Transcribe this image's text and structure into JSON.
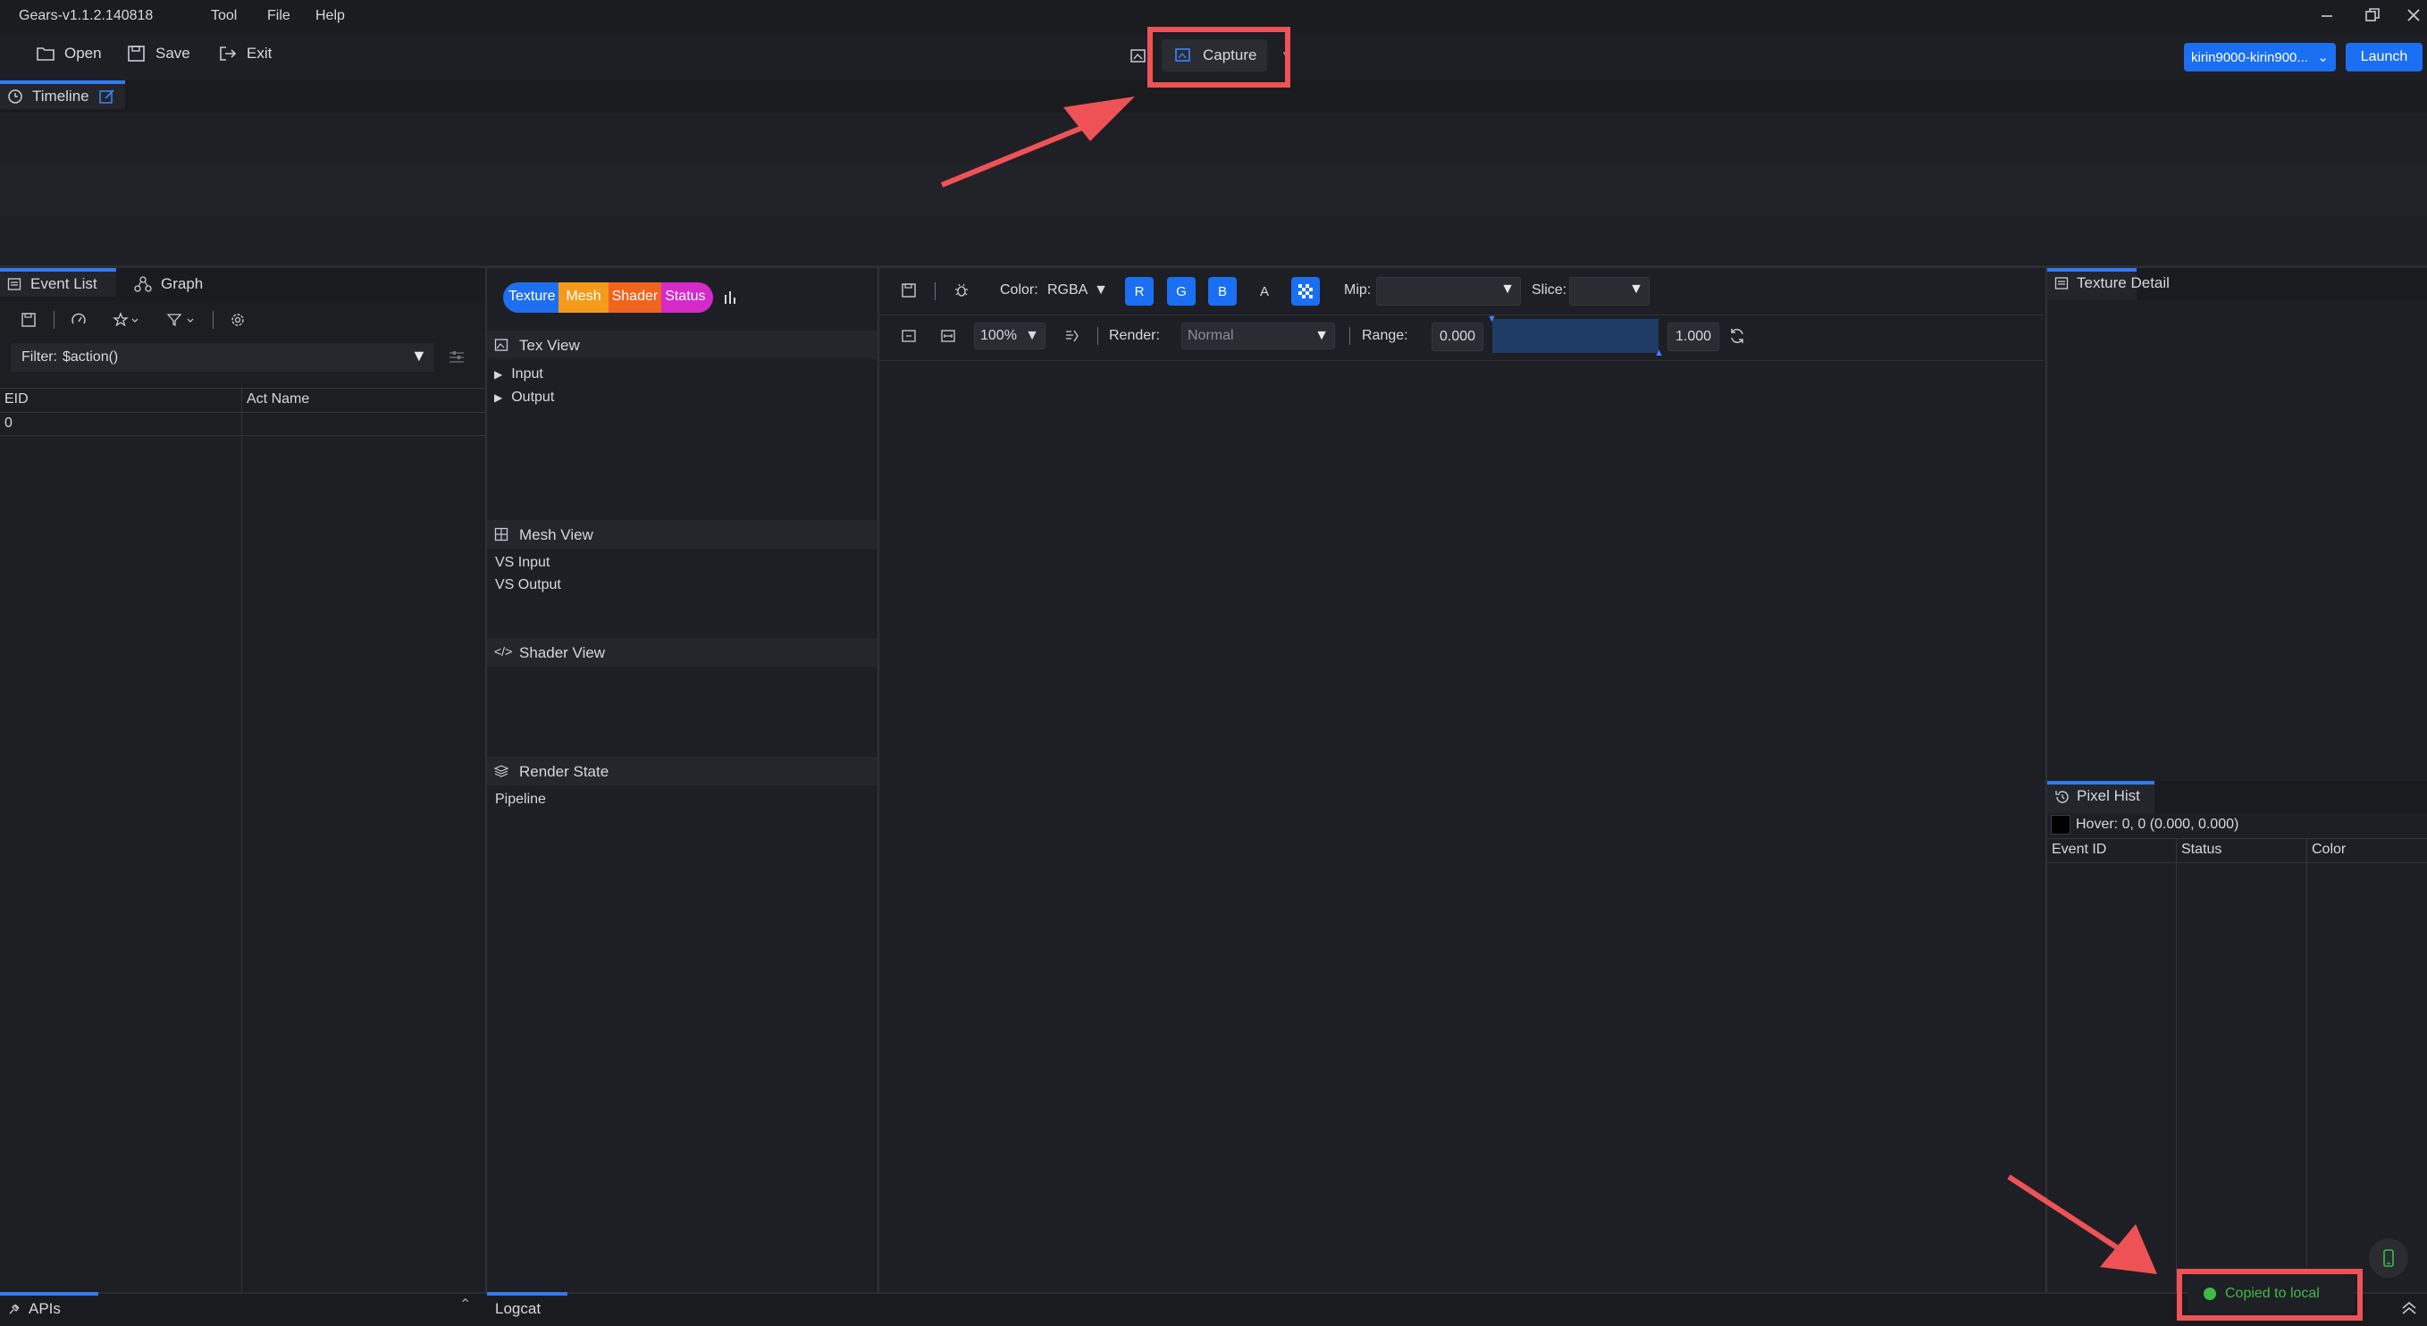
{
  "app": {
    "title": "Gears-v1.1.2.140818",
    "menu": [
      "Tool",
      "File",
      "Help"
    ]
  },
  "toolbar": {
    "open_label": "Open",
    "save_label": "Save",
    "exit_label": "Exit",
    "capture_label": "Capture",
    "device_value": "kirin9000-kirin900...",
    "launch_label": "Launch"
  },
  "timeline": {
    "tab_label": "Timeline"
  },
  "left_panel": {
    "tabs": [
      "Event List",
      "Graph"
    ],
    "filter_label": "Filter:",
    "filter_value": "$action()",
    "columns": [
      "EID",
      "Act Name"
    ],
    "rows": [
      [
        "0",
        ""
      ]
    ]
  },
  "mid_panel": {
    "pills": [
      "Texture",
      "Mesh",
      "Shader",
      "Status"
    ],
    "pill_colors": [
      "#1e6ff0",
      "#f59b1b",
      "#f0641e",
      "#d629c9"
    ],
    "tex_view": {
      "title": "Tex View",
      "items": [
        "Input",
        "Output"
      ]
    },
    "mesh_view": {
      "title": "Mesh View",
      "items": [
        "VS Input",
        "VS Output"
      ]
    },
    "shader_view": {
      "title": "Shader View"
    },
    "render_state": {
      "title": "Render State",
      "items": [
        "Pipeline"
      ]
    }
  },
  "viewer": {
    "color_label": "Color:",
    "color_value": "RGBA",
    "channels": [
      "R",
      "G",
      "B",
      "A"
    ],
    "mip_label": "Mip:",
    "slice_label": "Slice:",
    "zoom_value": "100%",
    "render_label": "Render:",
    "render_value": "Normal",
    "range_label": "Range:",
    "range_min": "0.000",
    "range_max": "1.000"
  },
  "right_panel": {
    "texture_detail_title": "Texture Detail",
    "pixel_hist_title": "Pixel Hist",
    "hover_text": "Hover: 0, 0 (0.000, 0.000)",
    "columns": [
      "Event ID",
      "Status",
      "Color"
    ]
  },
  "bottom": {
    "apis_label": "APIs",
    "logcat_label": "Logcat",
    "toast_text": "Copied to local"
  },
  "colors": {
    "accent": "#2f7bf5",
    "annotation": "#ef5256",
    "success": "#3fba47"
  }
}
